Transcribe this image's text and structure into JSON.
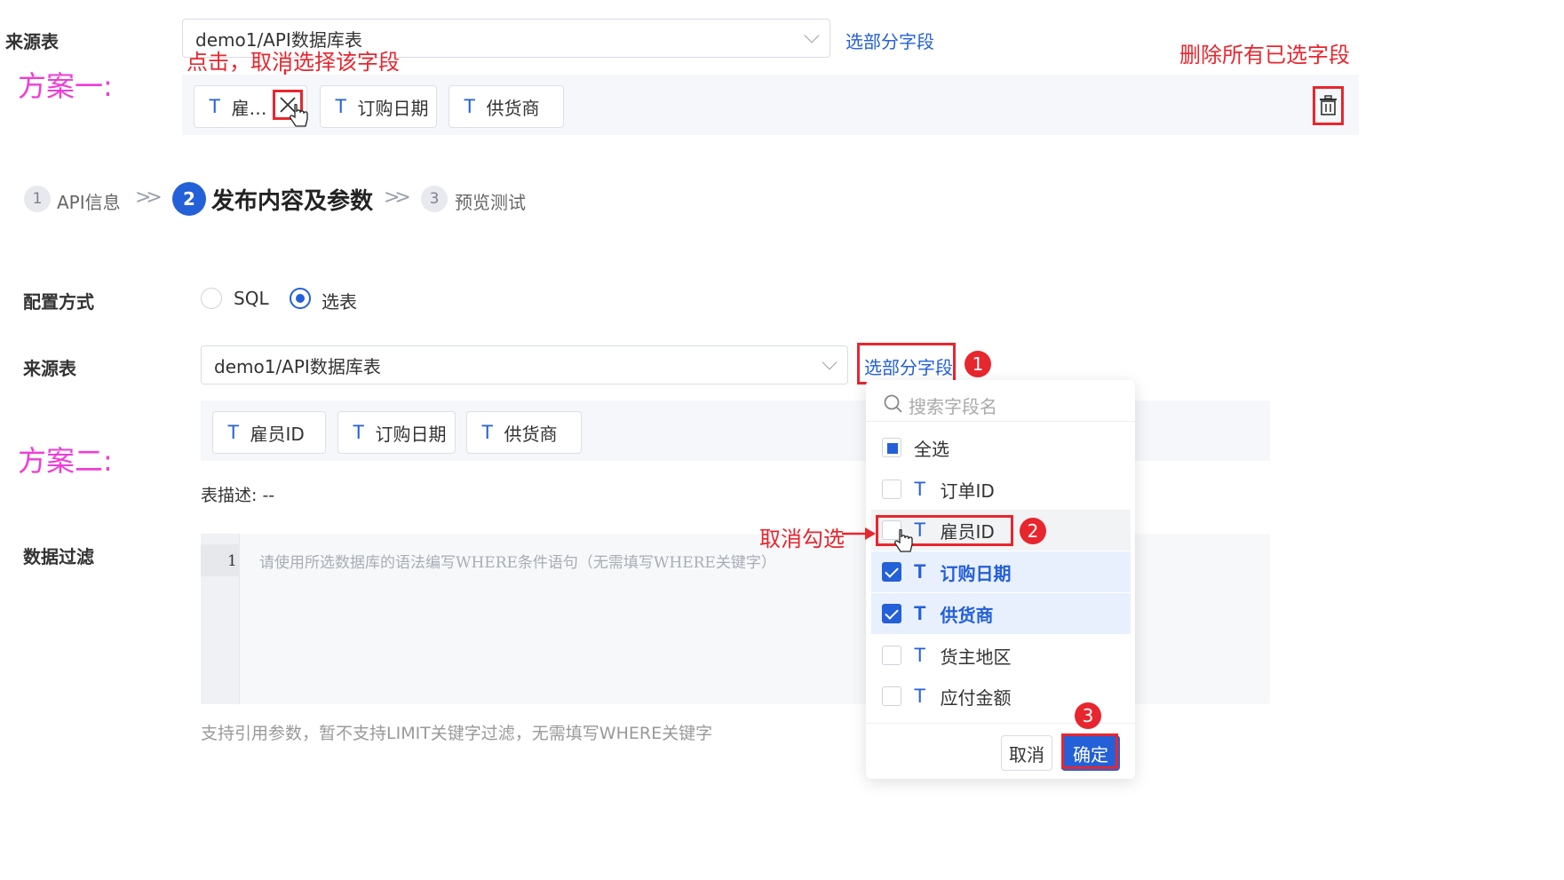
{
  "scheme1": {
    "label": "方案一:",
    "source_label": "来源表",
    "source_value": "demo1/API数据库表",
    "partial_link": "选部分字段",
    "note_click": "点击，取消选择该字段",
    "note_delete_all": "删除所有已选字段",
    "chips": [
      "雇…",
      "订购日期",
      "供货商"
    ],
    "trash_icon": "trash-icon",
    "close_icon": "close-icon"
  },
  "steps": [
    {
      "num": "1",
      "label": "API信息"
    },
    {
      "num": "2",
      "label": "发布内容及参数"
    },
    {
      "num": "3",
      "label": "预览测试"
    }
  ],
  "form": {
    "config_label": "配置方式",
    "radio_sql": "SQL",
    "radio_table": "选表",
    "selected_radio": "选表",
    "source_label": "来源表",
    "source_value": "demo1/API数据库表",
    "partial_link": "选部分字段",
    "chips": [
      "雇员ID",
      "订购日期",
      "供货商"
    ],
    "table_desc": "表描述: --",
    "filter_label": "数据过滤",
    "line_number": "1",
    "filter_placeholder": "请使用所选数据库的语法编写WHERE条件语句（无需填写WHERE关键字）",
    "filter_hint": "支持引用参数，暂不支持LIMIT关键字过滤，无需填写WHERE关键字"
  },
  "scheme2": {
    "label": "方案二:",
    "note_uncheck": "取消勾选"
  },
  "dropdown": {
    "search_placeholder": "搜索字段名",
    "select_all": "全选",
    "options": [
      {
        "label": "订单ID",
        "checked": false
      },
      {
        "label": "雇员ID",
        "checked": false
      },
      {
        "label": "订购日期",
        "checked": true
      },
      {
        "label": "供货商",
        "checked": true
      },
      {
        "label": "货主地区",
        "checked": false
      },
      {
        "label": "应付金额",
        "checked": false
      }
    ],
    "cancel": "取消",
    "confirm": "确定"
  },
  "badges": [
    "1",
    "2",
    "3"
  ],
  "colors": {
    "accent": "#2460d8",
    "annotation_red": "#e8262e",
    "annotation_pink": "#f03cd7"
  }
}
